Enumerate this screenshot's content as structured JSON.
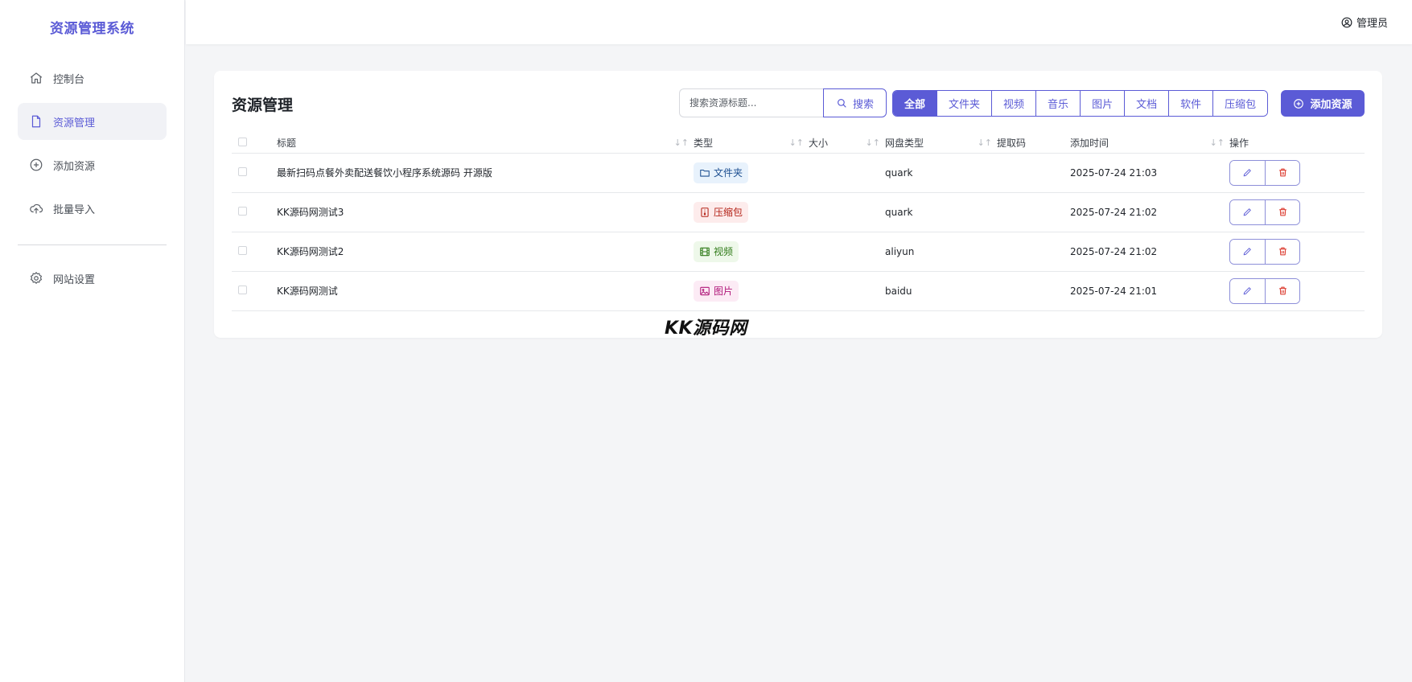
{
  "app": {
    "title": "资源管理系统"
  },
  "sidebar": {
    "items": [
      {
        "label": "控制台",
        "icon": "home-icon",
        "active": false
      },
      {
        "label": "资源管理",
        "icon": "file-icon",
        "active": true
      },
      {
        "label": "添加资源",
        "icon": "plus-circle-icon",
        "active": false
      },
      {
        "label": "批量导入",
        "icon": "cloud-upload-icon",
        "active": false
      }
    ],
    "settings": {
      "label": "网站设置",
      "icon": "gear-icon"
    }
  },
  "header": {
    "user": "管理员"
  },
  "main": {
    "title": "资源管理",
    "search": {
      "placeholder": "搜索资源标题...",
      "button": "搜索"
    },
    "filters": [
      "全部",
      "文件夹",
      "视频",
      "音乐",
      "图片",
      "文档",
      "软件",
      "压缩包"
    ],
    "active_filter": "全部",
    "add_button": "添加资源",
    "table": {
      "columns": [
        "标题",
        "类型",
        "大小",
        "网盘类型",
        "提取码",
        "添加时间",
        "操作"
      ],
      "rows": [
        {
          "title": "最新扫码点餐外卖配送餐饮小程序系统源码 开源版",
          "type": "文件夹",
          "size": "",
          "disk": "quark",
          "code": "",
          "time": "2025-07-24 21:03"
        },
        {
          "title": "KK源码网测试3",
          "type": "压缩包",
          "size": "",
          "disk": "quark",
          "code": "",
          "time": "2025-07-24 21:02"
        },
        {
          "title": "KK源码网测试2",
          "type": "视频",
          "size": "",
          "disk": "aliyun",
          "code": "",
          "time": "2025-07-24 21:02"
        },
        {
          "title": "KK源码网测试",
          "type": "图片",
          "size": "",
          "disk": "baidu",
          "code": "",
          "time": "2025-07-24 21:01"
        }
      ]
    }
  },
  "watermark": "KK源码网",
  "colors": {
    "accent": "#5b5bd6",
    "danger": "#d92d20"
  }
}
